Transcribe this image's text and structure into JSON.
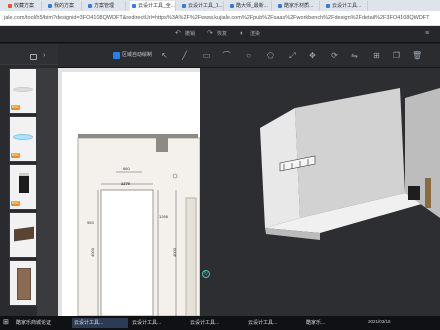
{
  "browser": {
    "tabs": [
      {
        "title": "收藏方案",
        "icon_color": "#e8532b"
      },
      {
        "title": "我的方案",
        "icon_color": "#2f7de1"
      },
      {
        "title": "方案管理",
        "icon_color": "#2f7de1"
      },
      {
        "title": "云设计工具_全...",
        "icon_color": "#2f7de1",
        "active": true
      },
      {
        "title": "云设计工具_1...",
        "icon_color": "#2f7de1"
      },
      {
        "title": "酷大师_最新...",
        "icon_color": "#2f7de1"
      },
      {
        "title": "酷家乐材质...",
        "icon_color": "#2f7de1"
      },
      {
        "title": "云设计工具...",
        "icon_color": "#2f7de1"
      }
    ],
    "url": "jale.com/tool/h5/bim?designid=3FO4108QWDFT&redirectUrl=https%3A%2F%2Fwww.kujiale.com%2Fpub%2Fsaas%2Fworkbench%2Fdesign%2Fdetail%2F3FO4108QWDFT"
  },
  "app_header": {
    "menus": [
      "撤销",
      "恢复",
      "渲染"
    ]
  },
  "toolbar": {
    "checkbox_label": "区域自动绘制",
    "checkbox_checked": true,
    "tools": [
      "cursor-icon",
      "brush-icon",
      "rect-icon",
      "curve-icon",
      "line-icon",
      "circle-icon",
      "polygon-icon",
      "scale-icon",
      "move-icon",
      "rotate-icon",
      "mirror-icon",
      "grid-icon",
      "copy-icon",
      "trash-icon"
    ]
  },
  "left_panel": {
    "items": [
      {
        "name": "ceiling-light",
        "badge": "RBC"
      },
      {
        "name": "ceiling-light-blue",
        "badge": "RBC"
      },
      {
        "name": "spot-light",
        "badge": "RBC"
      },
      {
        "name": "wood-board",
        "badge": ""
      },
      {
        "name": "door",
        "badge": ""
      }
    ]
  },
  "plan": {
    "dims": [
      "1279",
      "660",
      "953",
      "1268",
      "4000",
      "4000"
    ]
  },
  "taskbar": {
    "items": [
      "酷家乐商城论证",
      "云设计工具...",
      "云设计工具...",
      "云设计工具...",
      "云设计工具...",
      "酷家乐..."
    ],
    "active_index": 1,
    "clock": "2021/03/16"
  }
}
